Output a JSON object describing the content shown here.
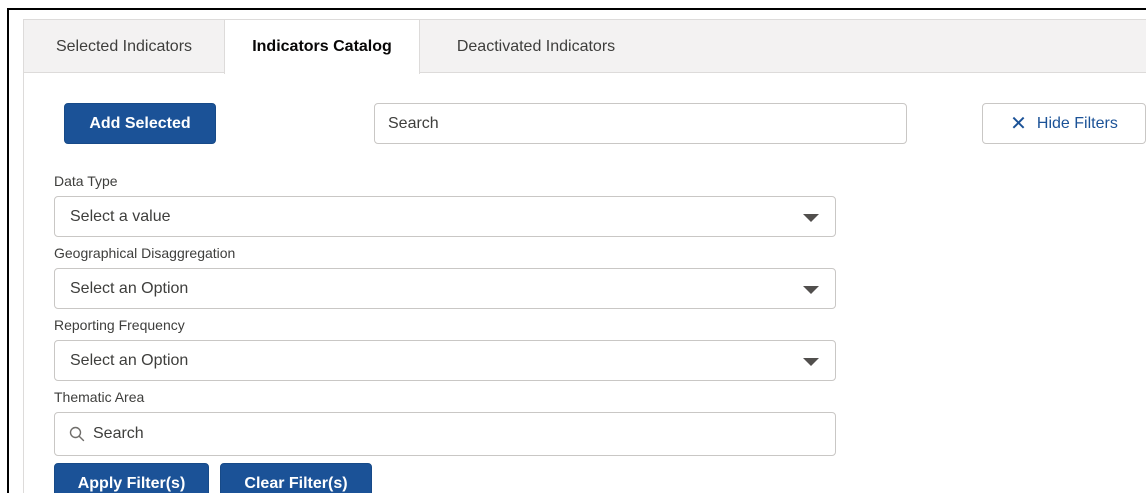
{
  "tabs": [
    {
      "label": "Selected Indicators",
      "active": false
    },
    {
      "label": "Indicators Catalog",
      "active": true
    },
    {
      "label": "Deactivated Indicators",
      "active": false
    }
  ],
  "toolbar": {
    "add_selected_label": "Add Selected",
    "search_placeholder": "Search",
    "hide_filters_icon": "close-icon",
    "hide_filters_label": "Hide Filters"
  },
  "filters": {
    "data_type": {
      "label": "Data Type",
      "value": "Select a value"
    },
    "geo": {
      "label": "Geographical Disaggregation",
      "value": "Select an Option"
    },
    "frequency": {
      "label": "Reporting Frequency",
      "value": "Select an Option"
    },
    "thematic": {
      "label": "Thematic Area",
      "search_icon": "search-icon",
      "placeholder": "Search"
    }
  },
  "actions": {
    "apply_label": "Apply Filter(s)",
    "clear_label": "Clear Filter(s)"
  },
  "colors": {
    "brand": "#1b5297",
    "tabbar_bg": "#f3f2f2",
    "border": "#c9c7c5"
  }
}
